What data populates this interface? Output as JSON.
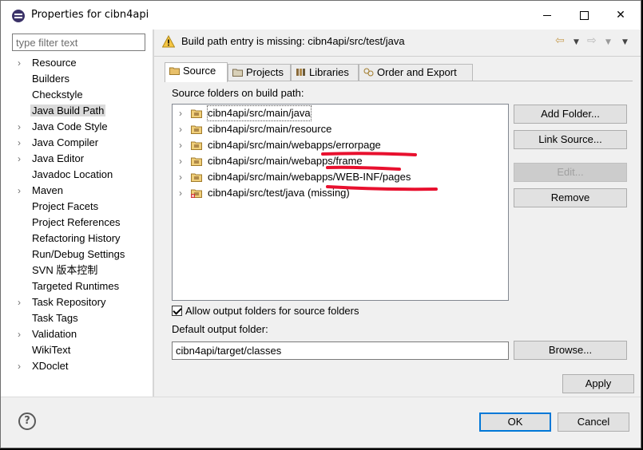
{
  "window": {
    "title": "Properties for cibn4api"
  },
  "filter": {
    "placeholder": "type filter text"
  },
  "nav": [
    {
      "label": "Resource",
      "expandable": true
    },
    {
      "label": "Builders",
      "expandable": false
    },
    {
      "label": "Checkstyle",
      "expandable": false
    },
    {
      "label": "Java Build Path",
      "expandable": false,
      "selected": true
    },
    {
      "label": "Java Code Style",
      "expandable": true
    },
    {
      "label": "Java Compiler",
      "expandable": true
    },
    {
      "label": "Java Editor",
      "expandable": true
    },
    {
      "label": "Javadoc Location",
      "expandable": false
    },
    {
      "label": "Maven",
      "expandable": true
    },
    {
      "label": "Project Facets",
      "expandable": false
    },
    {
      "label": "Project References",
      "expandable": false
    },
    {
      "label": "Refactoring History",
      "expandable": false
    },
    {
      "label": "Run/Debug Settings",
      "expandable": false
    },
    {
      "label": "SVN 版本控制",
      "expandable": false
    },
    {
      "label": "Targeted Runtimes",
      "expandable": false
    },
    {
      "label": "Task Repository",
      "expandable": true
    },
    {
      "label": "Task Tags",
      "expandable": false
    },
    {
      "label": "Validation",
      "expandable": true
    },
    {
      "label": "WikiText",
      "expandable": false
    },
    {
      "label": "XDoclet",
      "expandable": true
    }
  ],
  "header": {
    "message": "Build path entry is missing: cibn4api/src/test/java"
  },
  "tabs": {
    "source": "Source",
    "projects": "Projects",
    "libraries": "Libraries",
    "order": "Order and Export"
  },
  "source_panel": {
    "folders_label": "Source folders on build path:",
    "folders": [
      {
        "path": "cibn4api/src/main/java",
        "missing": false
      },
      {
        "path": "cibn4api/src/main/resource",
        "missing": false
      },
      {
        "path": "cibn4api/src/main/webapps/errorpage",
        "missing": false
      },
      {
        "path": "cibn4api/src/main/webapps/frame",
        "missing": false
      },
      {
        "path": "cibn4api/src/main/webapps/WEB-INF/pages",
        "missing": false
      },
      {
        "path": "cibn4api/src/test/java (missing)",
        "missing": true
      }
    ],
    "buttons": {
      "add_folder": "Add Folder...",
      "link_source": "Link Source...",
      "edit": "Edit...",
      "remove": "Remove"
    },
    "allow_output_label": "Allow output folders for source folders",
    "allow_output_checked": true,
    "default_output_label": "Default output folder:",
    "default_output_value": "cibn4api/target/classes",
    "browse": "Browse..."
  },
  "apply_label": "Apply",
  "footer": {
    "help": "?",
    "ok": "OK",
    "cancel": "Cancel"
  },
  "colors": {
    "accent": "#0078d7",
    "annotation": "#e8102e",
    "selection": "#dadada"
  }
}
